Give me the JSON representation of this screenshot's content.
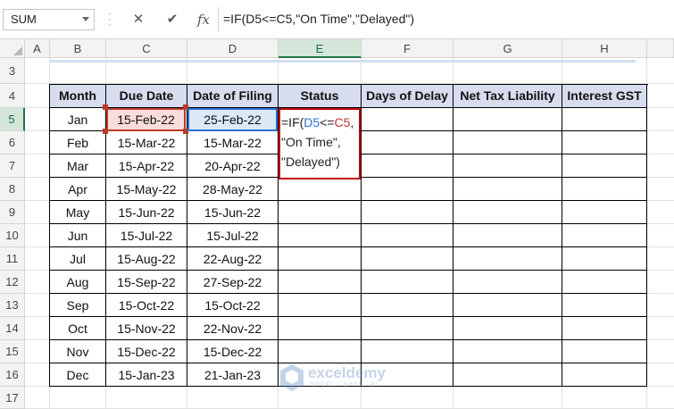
{
  "name_box": "SUM",
  "formula_bar": {
    "cancel_icon": "✕",
    "enter_icon": "✔",
    "fx_label": "fx",
    "formula": "=IF(D5<=C5,\"On Time\",\"Delayed\")"
  },
  "columns": [
    "A",
    "B",
    "C",
    "D",
    "E",
    "F",
    "G",
    "H"
  ],
  "rows": [
    "3",
    "4",
    "5",
    "6",
    "7",
    "8",
    "9",
    "10",
    "11",
    "12",
    "13",
    "14",
    "15",
    "16",
    "17"
  ],
  "table": {
    "headers": [
      "Month",
      "Due Date",
      "Date of Filing",
      "Status",
      "Days of Delay",
      "Net Tax Liability",
      "Interest GST"
    ],
    "rows": [
      [
        "Jan",
        "15-Feb-22",
        "25-Feb-22"
      ],
      [
        "Feb",
        "15-Mar-22",
        "15-Mar-22"
      ],
      [
        "Mar",
        "15-Apr-22",
        "20-Apr-22"
      ],
      [
        "Apr",
        "15-May-22",
        "28-May-22"
      ],
      [
        "May",
        "15-Jun-22",
        "15-Jun-22"
      ],
      [
        "Jun",
        "15-Jul-22",
        "15-Jul-22"
      ],
      [
        "Jul",
        "15-Aug-22",
        "22-Aug-22"
      ],
      [
        "Aug",
        "15-Sep-22",
        "27-Sep-22"
      ],
      [
        "Sep",
        "15-Oct-22",
        "15-Oct-22"
      ],
      [
        "Oct",
        "15-Nov-22",
        "22-Nov-22"
      ],
      [
        "Nov",
        "15-Dec-22",
        "15-Dec-22"
      ],
      [
        "Dec",
        "15-Jan-23",
        "21-Jan-23"
      ]
    ]
  },
  "edit_cell": {
    "line1_a": "=IF(",
    "line1_b": "D5",
    "line1_c": "<=",
    "line1_d": "C5",
    "line1_e": ",",
    "line2": "\"On Time\",",
    "line3": "\"Delayed\")"
  },
  "watermark": {
    "name": "exceldemy",
    "tagline": "EXCEL · DATA · BI"
  },
  "colors": {
    "header_fill": "#d7dcef",
    "ref_red": "#c0392b",
    "ref_blue": "#2e6fd1",
    "select_green": "#217346"
  }
}
